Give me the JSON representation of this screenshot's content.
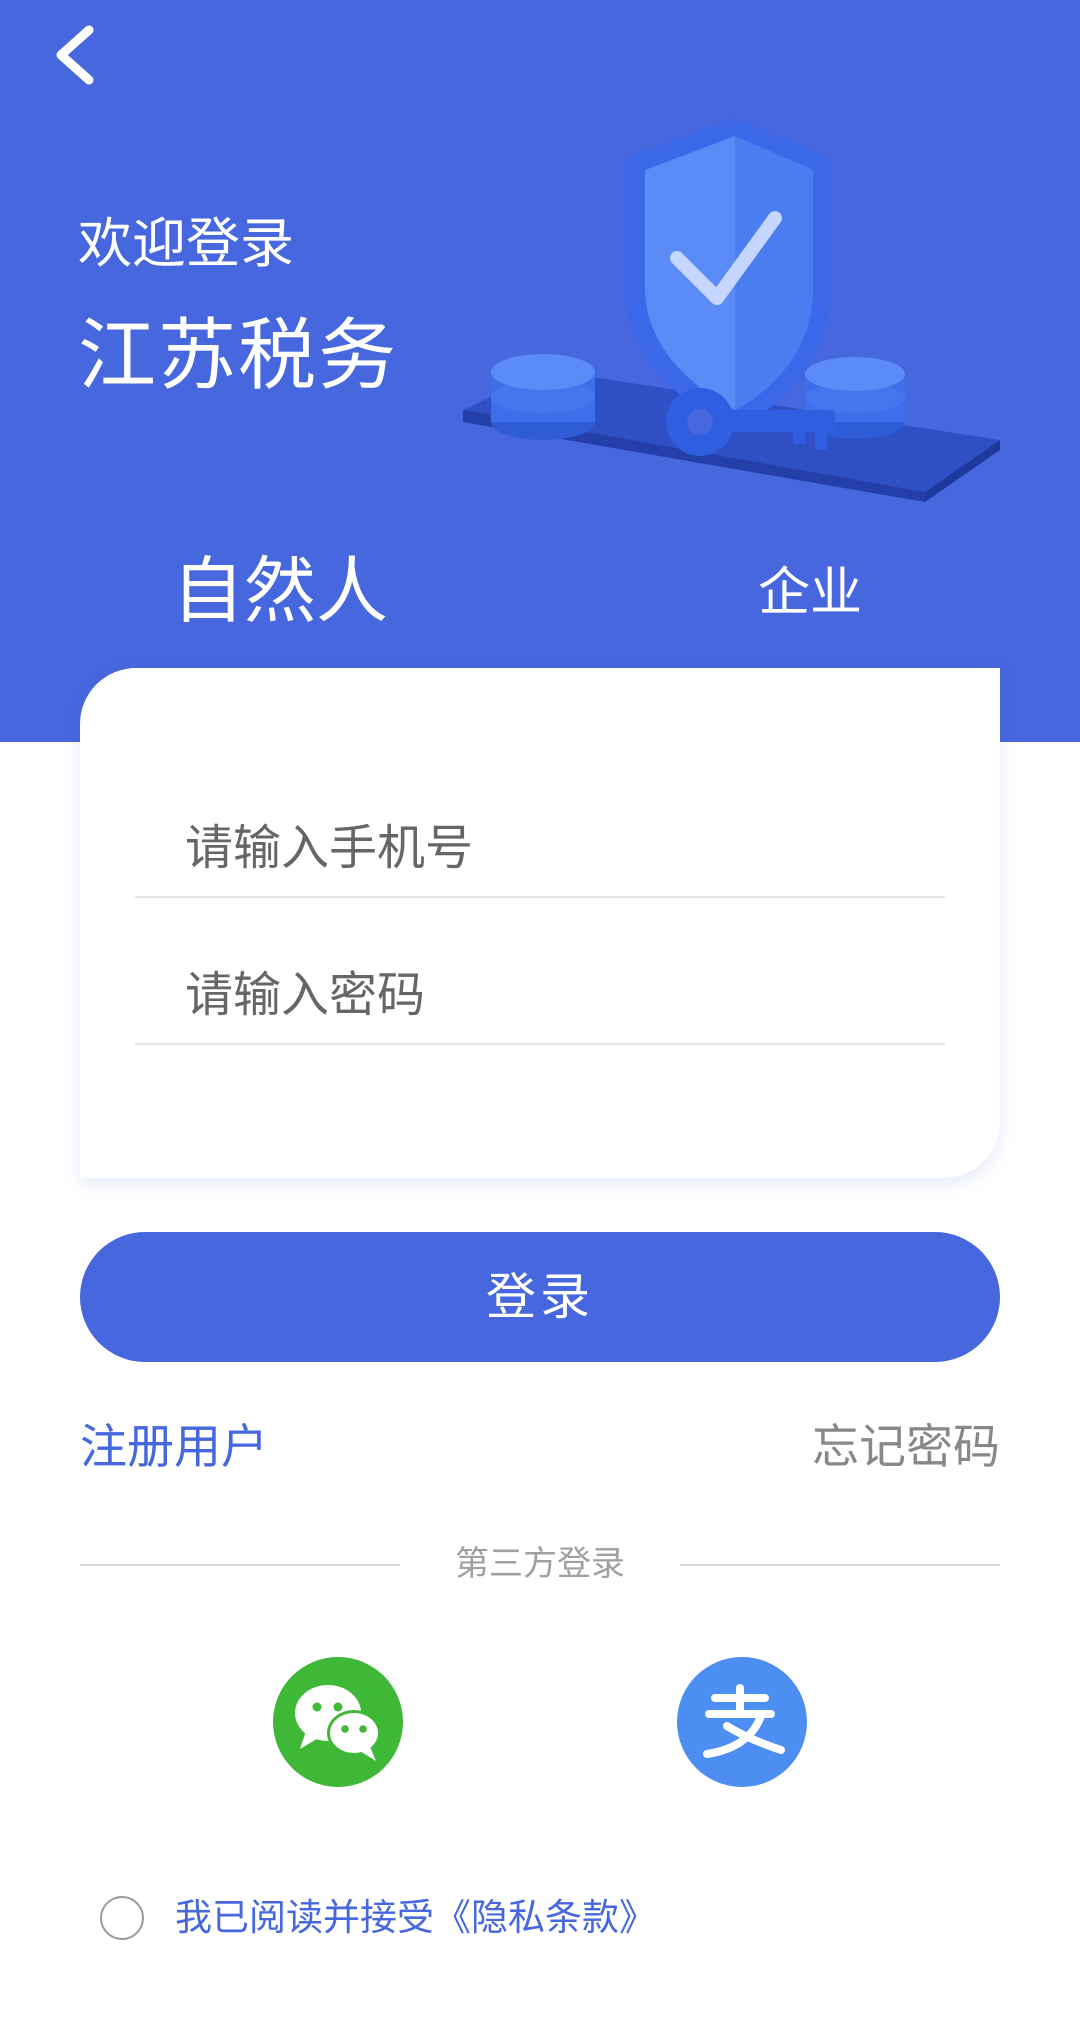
{
  "header": {
    "back_icon": "chevron-left-icon",
    "welcome": "欢迎登录",
    "title": "江苏税务",
    "illustration_icon": "shield-check-key-icon"
  },
  "tabs": [
    {
      "label": "自然人",
      "active": true
    },
    {
      "label": "企业",
      "active": false
    }
  ],
  "form": {
    "phone_placeholder": "请输入手机号",
    "phone_value": "",
    "password_placeholder": "请输入密码",
    "password_value": ""
  },
  "login_button": "登录",
  "links": {
    "register": "注册用户",
    "forgot": "忘记密码"
  },
  "third_party": {
    "label": "第三方登录",
    "providers": [
      {
        "icon": "wechat-icon"
      },
      {
        "icon": "alipay-icon"
      }
    ]
  },
  "agreement": {
    "checked": false,
    "text": "我已阅读并接受",
    "link": "《隐私条款》"
  },
  "colors": {
    "brand": "#4667de",
    "wechat": "#3fb837",
    "alipay": "#4d8ef2"
  }
}
